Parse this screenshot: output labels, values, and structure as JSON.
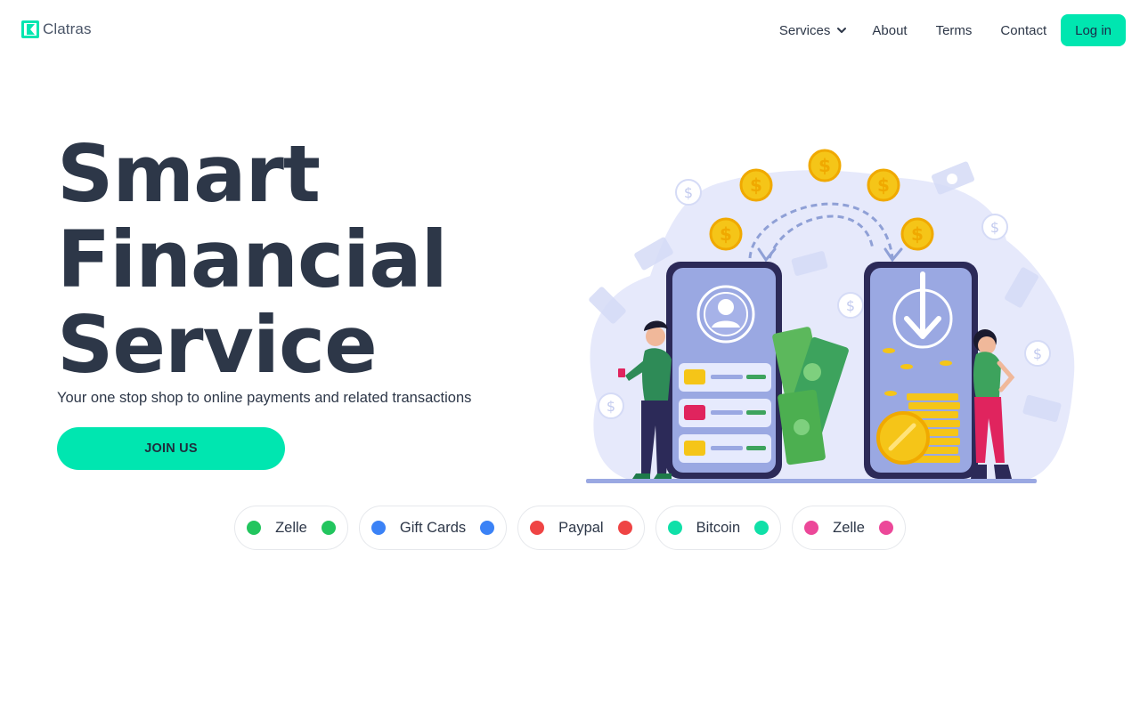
{
  "brand": {
    "name": "Clatras",
    "logo_icon": "brand-logo-icon",
    "accent": "#00e6b0"
  },
  "nav": {
    "services": "Services",
    "about": "About",
    "terms": "Terms",
    "contact": "Contact",
    "login": "Log in"
  },
  "hero": {
    "title_lines": [
      "Smart",
      "Financial",
      "Service"
    ],
    "subtitle": "Your one stop shop to online payments and related transactions",
    "cta": "JOIN US"
  },
  "payment_methods": [
    {
      "label": "Zelle",
      "color": "#22c55e"
    },
    {
      "label": "Gift Cards",
      "color": "#3b82f6"
    },
    {
      "label": "Paypal",
      "color": "#ef4444"
    },
    {
      "label": "Bitcoin",
      "color": "#10e0a8"
    },
    {
      "label": "Zelle",
      "color": "#ec4899"
    }
  ]
}
